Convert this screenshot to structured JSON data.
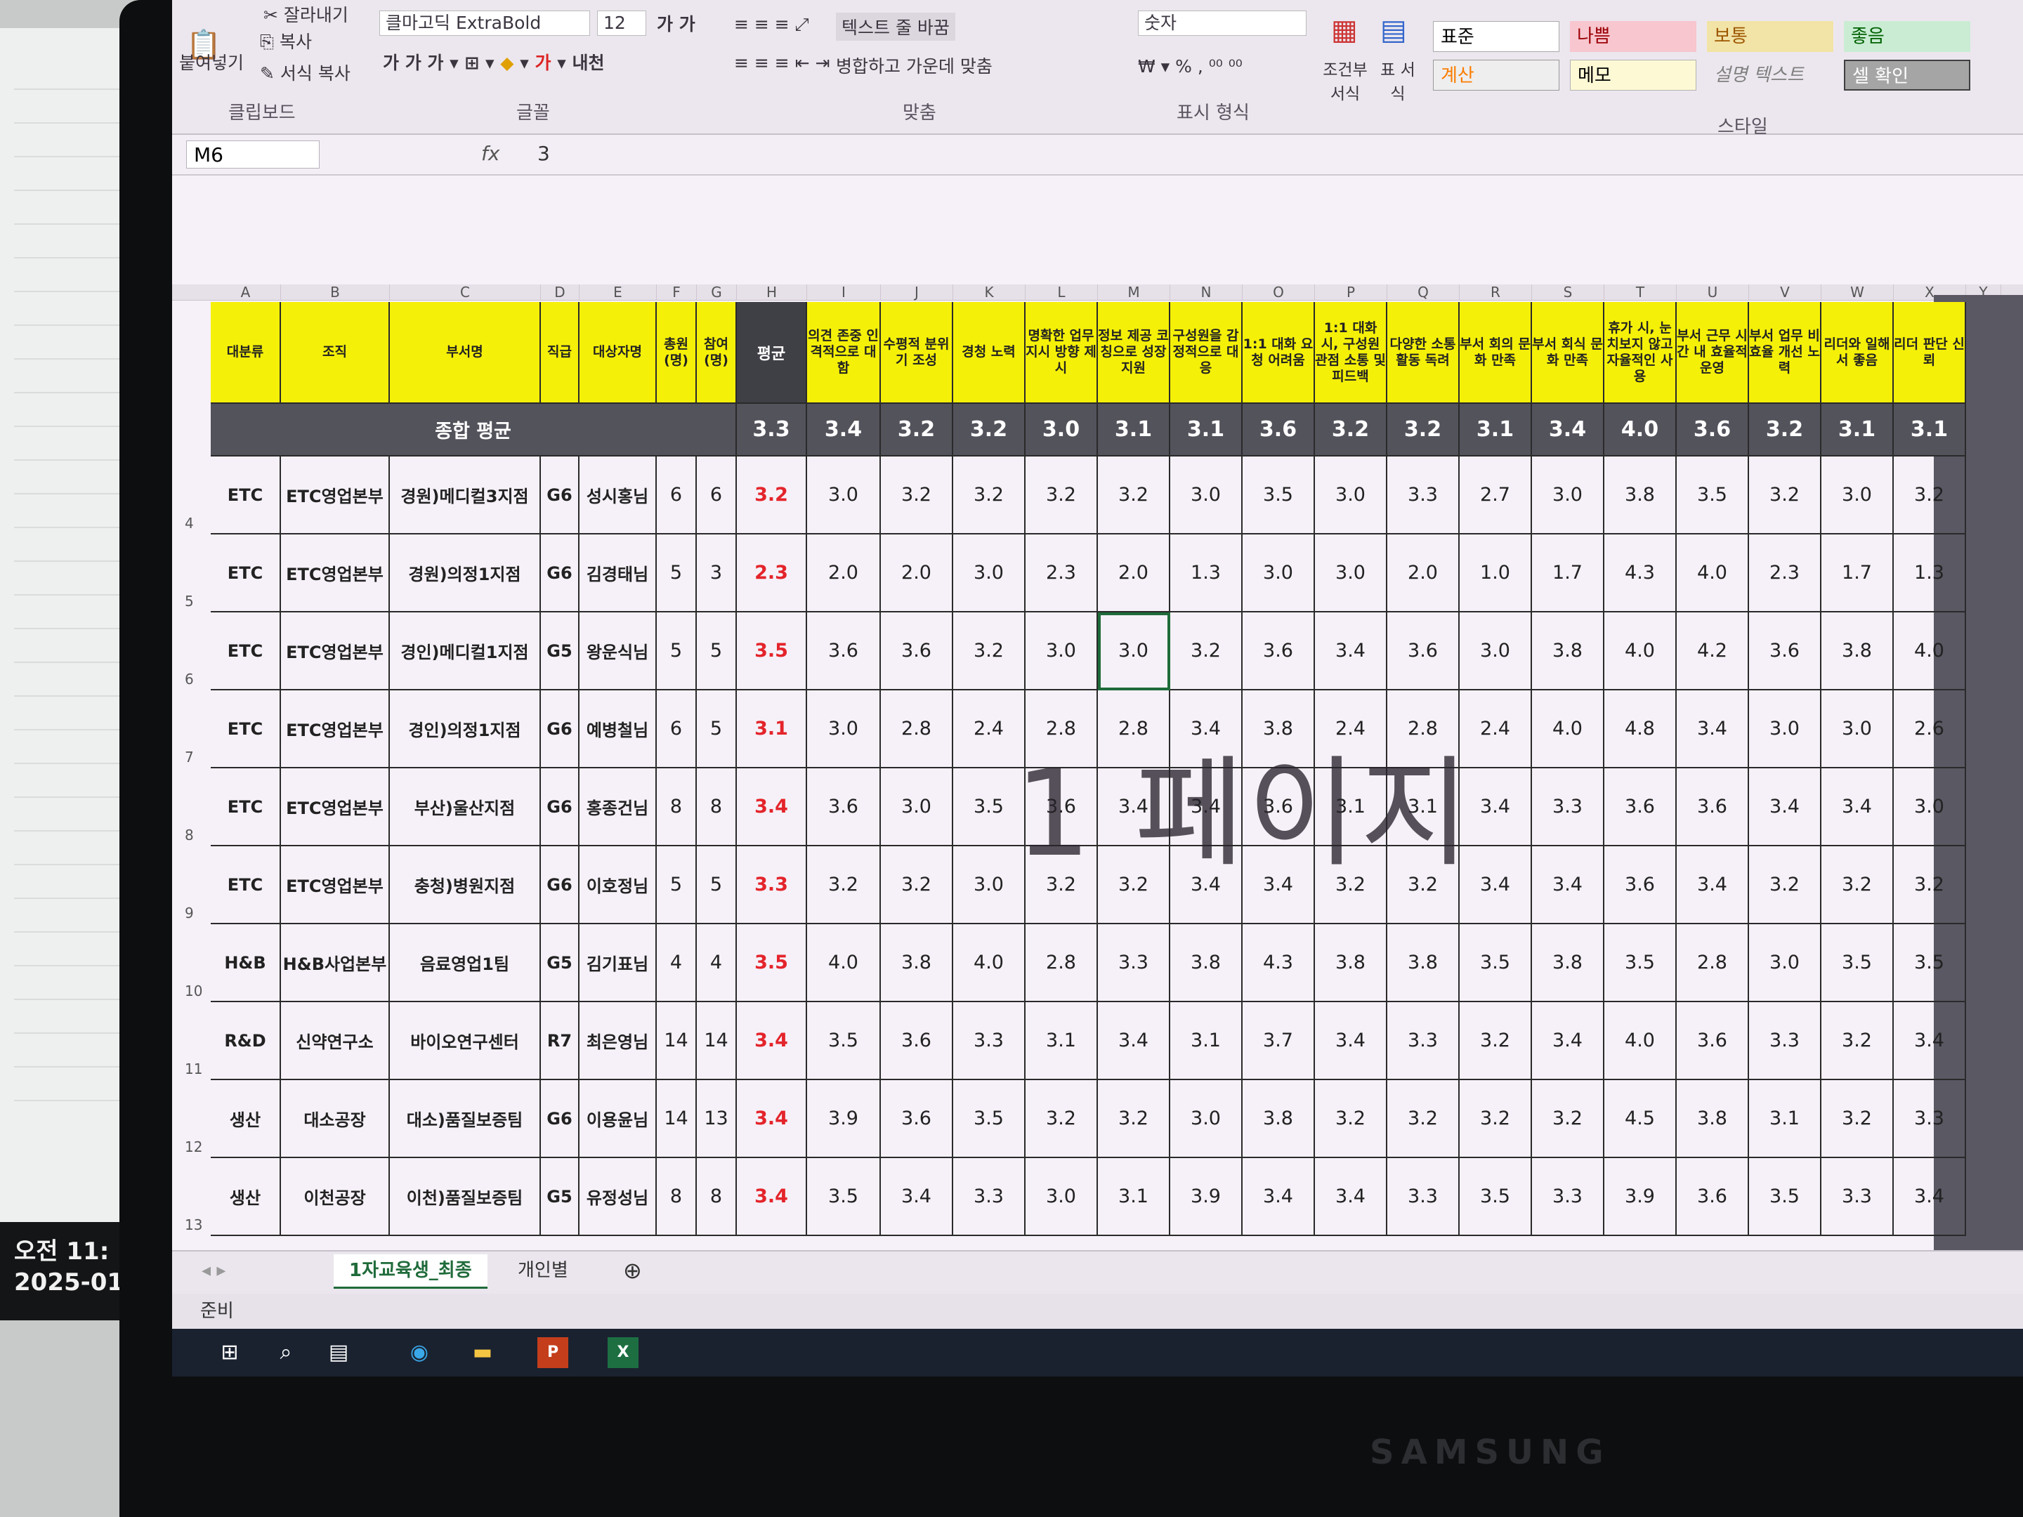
{
  "ribbon": {
    "clipboard": {
      "cut": "잘라내기",
      "copy": "복사",
      "format_painter": "서식 복사",
      "paste": "붙여넣기",
      "group": "클립보드"
    },
    "font": {
      "name": "클마고딕 ExtraBold",
      "size": "12",
      "group": "글꼴"
    },
    "alignment": {
      "wrap": "텍스트 줄 바꿈",
      "merge": "병합하고 가운데 맞춤",
      "group": "맞춤"
    },
    "number": {
      "format": "숫자",
      "group": "표시 형식"
    },
    "cond": {
      "cond_format": "조건부 서식",
      "table_format": "표 서식"
    },
    "styles": {
      "group": "스타일",
      "items": [
        "표준",
        "나쁨",
        "보통",
        "좋음",
        "계산",
        "메모",
        "설명 텍스트",
        "셀 확인"
      ]
    }
  },
  "formula_bar": {
    "name_box": "M6",
    "fx": "fx",
    "value": "3"
  },
  "columns": [
    "A",
    "B",
    "C",
    "D",
    "E",
    "F",
    "G",
    "H",
    "I",
    "J",
    "K",
    "L",
    "M",
    "N",
    "O",
    "P",
    "Q",
    "R",
    "S",
    "T",
    "U",
    "V",
    "W",
    "X",
    "Y"
  ],
  "headers": [
    "대분류",
    "조직",
    "부서명",
    "직급",
    "대상자명",
    "총원 (명)",
    "참여 (명)",
    "평균",
    "의견 존중 인격적으로 대함",
    "수평적 분위기 조성",
    "경청 노력",
    "명확한 업무 지시 방향 제시",
    "정보 제공 코칭으로 성장 지원",
    "구성원을 감정적으로 대응",
    "1:1 대화 요청 어려움",
    "1:1 대화 시, 구성원 관점 소통 및 피드백",
    "다양한 소통 활동 독려",
    "부서 회의 문화 만족",
    "부서 회식 문화 만족",
    "휴가 시, 눈치보지 않고 자율적인 사용",
    "부서 근무 시간 내 효율적 운영",
    "부서 업무 비효율 개선 노력",
    "리더와 일해서 좋음",
    "리더 판단 신뢰"
  ],
  "total_row": {
    "label": "종합 평균",
    "values": [
      "3.3",
      "3.4",
      "3.2",
      "3.2",
      "3.0",
      "3.1",
      "3.1",
      "3.6",
      "3.2",
      "3.2",
      "3.1",
      "3.4",
      "4.0",
      "3.6",
      "3.2",
      "3.1",
      "3.1"
    ]
  },
  "rows": [
    {
      "num": "4",
      "a": "ETC",
      "b": "ETC영업본부",
      "c": "경원)메디컬3지점",
      "d": "G6",
      "e": "성시홍님",
      "f": "6",
      "g": "6",
      "h": "3.2",
      "v": [
        "3.0",
        "3.2",
        "3.2",
        "3.2",
        "3.2",
        "3.0",
        "3.5",
        "3.0",
        "3.3",
        "2.7",
        "3.0",
        "3.8",
        "3.5",
        "3.2",
        "3.0",
        "3.2"
      ]
    },
    {
      "num": "5",
      "a": "ETC",
      "b": "ETC영업본부",
      "c": "경원)의정1지점",
      "d": "G6",
      "e": "김경태님",
      "f": "5",
      "g": "3",
      "h": "2.3",
      "v": [
        "2.0",
        "2.0",
        "3.0",
        "2.3",
        "2.0",
        "1.3",
        "3.0",
        "3.0",
        "2.0",
        "1.0",
        "1.7",
        "4.3",
        "4.0",
        "2.3",
        "1.7",
        "1.3"
      ]
    },
    {
      "num": "6",
      "a": "ETC",
      "b": "ETC영업본부",
      "c": "경인)메디컬1지점",
      "d": "G5",
      "e": "왕운식님",
      "f": "5",
      "g": "5",
      "h": "3.5",
      "v": [
        "3.6",
        "3.6",
        "3.2",
        "3.0",
        "3.0",
        "3.2",
        "3.6",
        "3.4",
        "3.6",
        "3.0",
        "3.8",
        "4.0",
        "4.2",
        "3.6",
        "3.8",
        "4.0"
      ]
    },
    {
      "num": "7",
      "a": "ETC",
      "b": "ETC영업본부",
      "c": "경인)의정1지점",
      "d": "G6",
      "e": "예병철님",
      "f": "6",
      "g": "5",
      "h": "3.1",
      "v": [
        "3.0",
        "2.8",
        "2.4",
        "2.8",
        "2.8",
        "3.4",
        "3.8",
        "2.4",
        "2.8",
        "2.4",
        "4.0",
        "4.8",
        "3.4",
        "3.0",
        "3.0",
        "2.6"
      ]
    },
    {
      "num": "8",
      "a": "ETC",
      "b": "ETC영업본부",
      "c": "부산)울산지점",
      "d": "G6",
      "e": "홍종건님",
      "f": "8",
      "g": "8",
      "h": "3.4",
      "v": [
        "3.6",
        "3.0",
        "3.5",
        "3.6",
        "3.4",
        "3.4",
        "3.6",
        "3.1",
        "3.1",
        "3.4",
        "3.3",
        "3.6",
        "3.6",
        "3.4",
        "3.4",
        "3.0"
      ]
    },
    {
      "num": "9",
      "a": "ETC",
      "b": "ETC영업본부",
      "c": "충청)병원지점",
      "d": "G6",
      "e": "이호정님",
      "f": "5",
      "g": "5",
      "h": "3.3",
      "v": [
        "3.2",
        "3.2",
        "3.0",
        "3.2",
        "3.2",
        "3.4",
        "3.4",
        "3.2",
        "3.2",
        "3.4",
        "3.4",
        "3.6",
        "3.4",
        "3.2",
        "3.2",
        "3.2"
      ]
    },
    {
      "num": "10",
      "a": "H&B",
      "b": "H&B사업본부",
      "c": "음료영업1팀",
      "d": "G5",
      "e": "김기표님",
      "f": "4",
      "g": "4",
      "h": "3.5",
      "v": [
        "4.0",
        "3.8",
        "4.0",
        "2.8",
        "3.3",
        "3.8",
        "4.3",
        "3.8",
        "3.8",
        "3.5",
        "3.8",
        "3.5",
        "2.8",
        "3.0",
        "3.5",
        "3.5"
      ]
    },
    {
      "num": "11",
      "a": "R&D",
      "b": "신약연구소",
      "c": "바이오연구센터",
      "d": "R7",
      "e": "최은영님",
      "f": "14",
      "g": "14",
      "h": "3.4",
      "v": [
        "3.5",
        "3.6",
        "3.3",
        "3.1",
        "3.4",
        "3.1",
        "3.7",
        "3.4",
        "3.3",
        "3.2",
        "3.4",
        "4.0",
        "3.6",
        "3.3",
        "3.2",
        "3.4"
      ]
    },
    {
      "num": "12",
      "a": "생산",
      "b": "대소공장",
      "c": "대소)품질보증팀",
      "d": "G6",
      "e": "이용윤님",
      "f": "14",
      "g": "13",
      "h": "3.4",
      "v": [
        "3.9",
        "3.6",
        "3.5",
        "3.2",
        "3.2",
        "3.0",
        "3.8",
        "3.2",
        "3.2",
        "3.2",
        "3.2",
        "4.5",
        "3.8",
        "3.1",
        "3.2",
        "3.3"
      ]
    },
    {
      "num": "13",
      "a": "생산",
      "b": "이천공장",
      "c": "이천)품질보증팀",
      "d": "G5",
      "e": "유정성님",
      "f": "8",
      "g": "8",
      "h": "3.4",
      "v": [
        "3.5",
        "3.4",
        "3.3",
        "3.0",
        "3.1",
        "3.9",
        "3.4",
        "3.4",
        "3.3",
        "3.5",
        "3.3",
        "3.9",
        "3.6",
        "3.5",
        "3.3",
        "3.4"
      ]
    }
  ],
  "watermark": "1 페이지",
  "sheet_tabs": [
    "1자교육생_최종",
    "개인별"
  ],
  "status": "준비",
  "left_clock": {
    "time": "오전 11:",
    "date": "2025-01-"
  },
  "monitor_brand": "SAMSUNG"
}
